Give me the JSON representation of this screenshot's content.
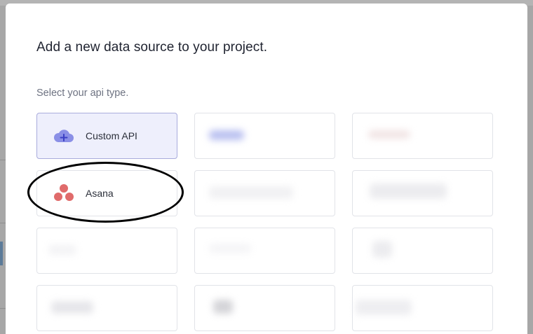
{
  "modal": {
    "title": "Add a new data source to your project.",
    "subtitle": "Select your api type."
  },
  "cards": [
    {
      "label": "Custom API",
      "icon": "cloud-plus-icon",
      "selected": true
    },
    {
      "label": "Asana",
      "icon": "asana-logo-icon",
      "selected": false
    }
  ],
  "colors": {
    "selected_bg": "#eeeffc",
    "selected_border": "#a9acdc",
    "cloud": "#8a8fe6",
    "asana": "#e06b6b"
  }
}
